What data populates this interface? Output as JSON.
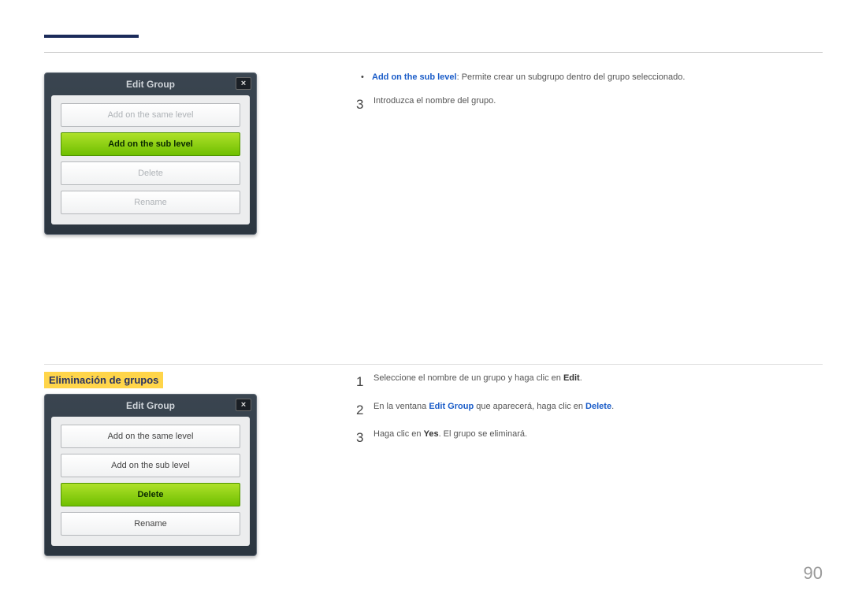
{
  "dialog1": {
    "title": "Edit Group",
    "close": "×",
    "options": {
      "same": "Add on the same level",
      "sub": "Add on the sub level",
      "delete": "Delete",
      "rename": "Rename"
    }
  },
  "top_right": {
    "bullet_term": "Add on the sub level",
    "bullet_rest": ": Permite crear un subgrupo dentro del grupo seleccionado.",
    "step3_num": "3",
    "step3_text": "Introduzca el nombre del grupo."
  },
  "section_heading": "Eliminación de grupos",
  "dialog2": {
    "title": "Edit Group",
    "close": "×",
    "options": {
      "same": "Add on the same level",
      "sub": "Add on the sub level",
      "delete": "Delete",
      "rename": "Rename"
    }
  },
  "bottom_right": {
    "step1_num": "1",
    "step1_a": "Seleccione el nombre de un grupo y haga clic en ",
    "step1_b": "Edit",
    "step1_c": ".",
    "step2_num": "2",
    "step2_a": "En la ventana ",
    "step2_b": "Edit Group",
    "step2_c": " que aparecerá, haga clic en ",
    "step2_d": "Delete",
    "step2_e": ".",
    "step3_num": "3",
    "step3_a": "Haga clic en ",
    "step3_b": "Yes",
    "step3_c": ". El grupo se eliminará."
  },
  "page_number": "90"
}
